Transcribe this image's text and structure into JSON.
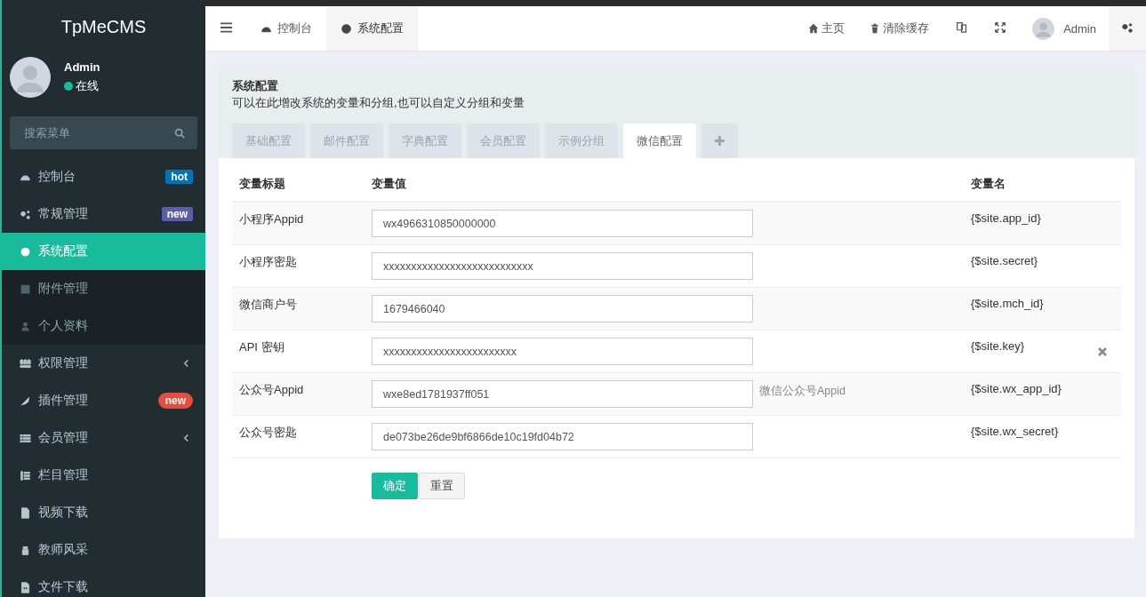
{
  "sidebar": {
    "logo": "TpMeCMS",
    "user": {
      "name": "Admin",
      "status": "在线"
    },
    "search": {
      "placeholder": "搜索菜单"
    },
    "items": [
      {
        "label": "控制台",
        "selected": false,
        "badge": {
          "text": "hot",
          "color": "#0073b7",
          "kind": "tag"
        }
      },
      {
        "label": "常规管理",
        "selected": false,
        "expanded": true,
        "badge": {
          "text": "new",
          "color": "#605ca8",
          "kind": "tag"
        },
        "children": [
          {
            "label": "系统配置",
            "selected": true
          },
          {
            "label": "附件管理",
            "selected": false
          },
          {
            "label": "个人资料",
            "selected": false
          }
        ]
      },
      {
        "label": "权限管理",
        "selected": false,
        "expanded": false
      },
      {
        "label": "插件管理",
        "selected": false,
        "badge": {
          "text": "new",
          "color": "#e74c3c",
          "kind": "pill"
        }
      },
      {
        "label": "会员管理",
        "selected": false,
        "expanded": false
      },
      {
        "label": "栏目管理",
        "selected": false
      },
      {
        "label": "视频下载",
        "selected": false
      },
      {
        "label": "教师风采",
        "selected": false
      },
      {
        "label": "文件下载",
        "selected": false
      }
    ]
  },
  "topbar": {
    "tabs": [
      {
        "label": "控制台",
        "selected": false
      },
      {
        "label": "系统配置",
        "selected": true
      }
    ],
    "links": [
      "主页",
      "清除缓存"
    ],
    "user": "Admin"
  },
  "panel": {
    "title": "系统配置",
    "description": "可以在此增改系统的变量和分组,也可以自定义分组和变量",
    "tabs": [
      {
        "label": "基础配置",
        "selected": false
      },
      {
        "label": "邮件配置",
        "selected": false
      },
      {
        "label": "字典配置",
        "selected": false
      },
      {
        "label": "会员配置",
        "selected": false
      },
      {
        "label": "示例分组",
        "selected": false
      },
      {
        "label": "微信配置",
        "selected": true
      }
    ],
    "add_tab": "✚",
    "columns": [
      "变量标题",
      "变量值",
      "变量名"
    ],
    "rows": [
      {
        "title": "小程序Appid",
        "value": "wx4966310850000000",
        "name": "{$site.app_id}",
        "removable": false
      },
      {
        "title": "小程序密匙",
        "value": "xxxxxxxxxxxxxxxxxxxxxxxxxxx",
        "name": "{$site.secret}",
        "removable": false
      },
      {
        "title": "微信商户号",
        "value": "1679466040",
        "name": "{$site.mch_id}",
        "removable": false
      },
      {
        "title": "API 密钥",
        "value": "xxxxxxxxxxxxxxxxxxxxxxxx",
        "name": "{$site.key}",
        "removable": true
      },
      {
        "title": "公众号Appid",
        "value": "wxe8ed1781937ff051",
        "hint": "微信公众号Appid",
        "name": "{$site.wx_app_id}",
        "removable": false
      },
      {
        "title": "公众号密匙",
        "value": "de073be26de9bf6866de10c19fd04b72",
        "name": "{$site.wx_secret}",
        "removable": false
      }
    ],
    "buttons": [
      "确定",
      "重置"
    ]
  }
}
